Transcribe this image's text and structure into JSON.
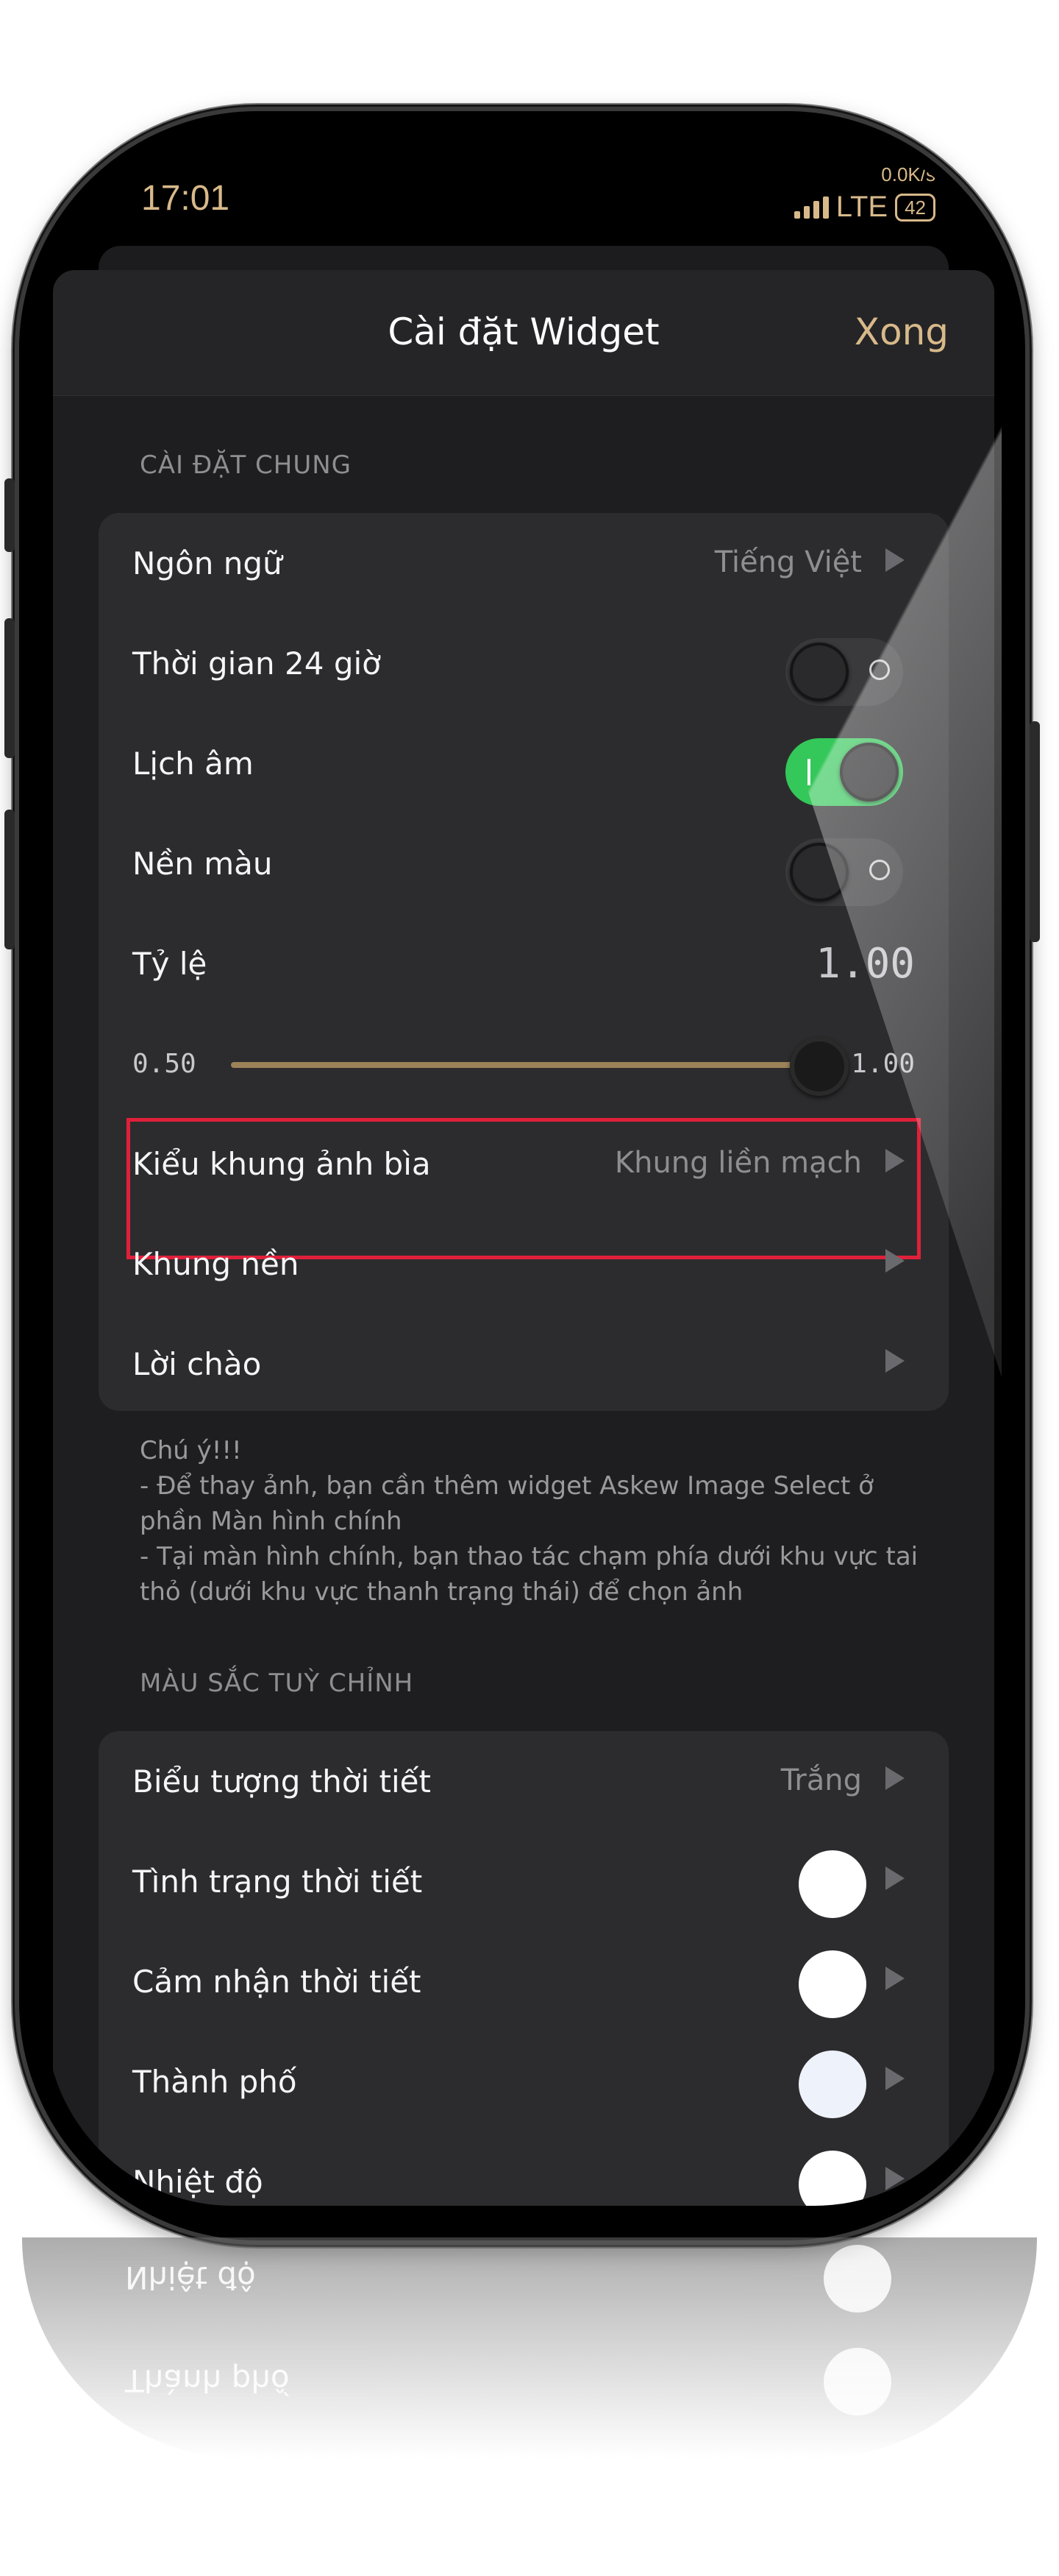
{
  "status": {
    "time": "17:01",
    "net_speed": "0.0K/s",
    "network": "LTE",
    "battery": "42"
  },
  "nav": {
    "title": "Cài đặt Widget",
    "done": "Xong"
  },
  "general": {
    "header": "CÀI ĐẶT CHUNG",
    "language": {
      "label": "Ngôn ngữ",
      "value": "Tiếng Việt"
    },
    "time24": {
      "label": "Thời gian 24 giờ",
      "on": false
    },
    "lunar": {
      "label": "Lịch âm",
      "on": true
    },
    "bgcolor": {
      "label": "Nền màu",
      "on": false
    },
    "scale": {
      "label": "Tỷ lệ",
      "value": "1.00"
    },
    "slider": {
      "min": "0.50",
      "max": "1.00",
      "level": 1.0
    },
    "cover_style": {
      "label": "Kiểu khung ảnh bìa",
      "value": "Khung liền mạch"
    },
    "bg_frame": {
      "label": "Khung nền"
    },
    "greeting": {
      "label": "Lời chào"
    }
  },
  "note": "Chú ý!!!\n- Để thay ảnh, bạn cần thêm widget Askew Image Select ở phần Màn hình chính\n- Tại màn hình chính, bạn thao tác chạm phía dưới khu vực tai thỏ (dưới khu vực thanh trạng thái) để chọn ảnh",
  "colors": {
    "header": "MÀU SẮC TUỲ CHỈNH",
    "weather_icon": {
      "label": "Biểu tượng thời tiết",
      "value": "Trắng"
    },
    "weather_status": {
      "label": "Tình trạng thời tiết",
      "color": "#ffffff"
    },
    "weather_feel": {
      "label": "Cảm nhận thời tiết",
      "color": "#ffffff"
    },
    "city": {
      "label": "Thành phố",
      "color": "#eef2fa"
    },
    "temperature": {
      "label": "Nhiệt độ",
      "color": "#ffffff"
    }
  },
  "reflection": {
    "temperature": "Nhiệt độ",
    "city": "Thành phố"
  },
  "accent": "#d8b98a",
  "toggle_on_color": "#34c759",
  "highlight_color": "#e0203a"
}
